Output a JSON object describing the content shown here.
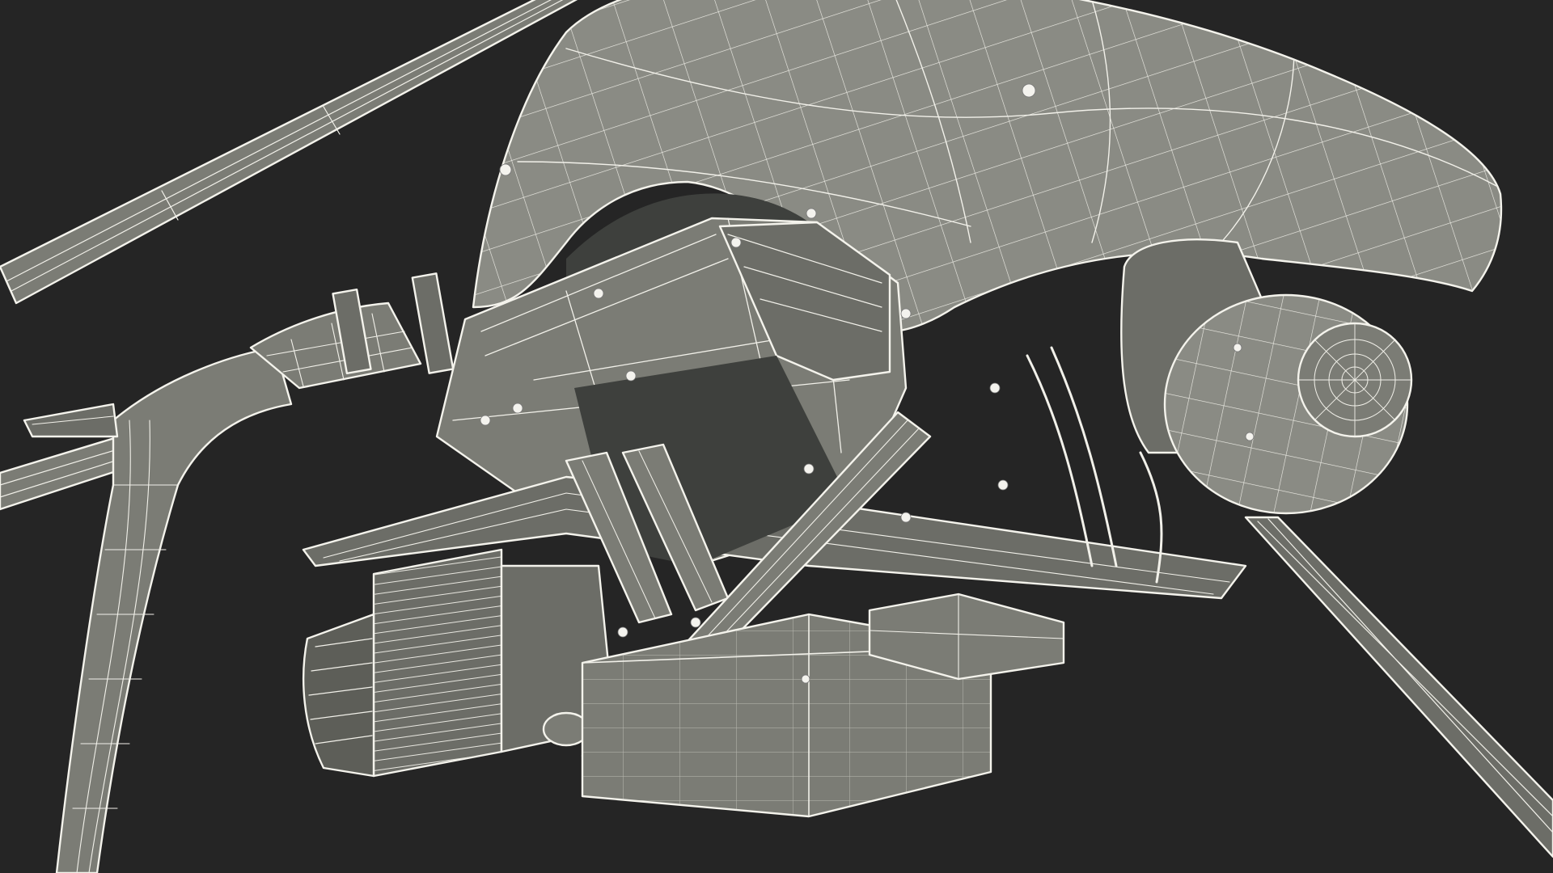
{
  "scene": {
    "subject": "helicopter-drone-underside-wireframe",
    "colors": {
      "background": "#252525",
      "body": "#7d7e77",
      "wire": "#f2f1ea",
      "shadow": "#3e403d"
    }
  }
}
